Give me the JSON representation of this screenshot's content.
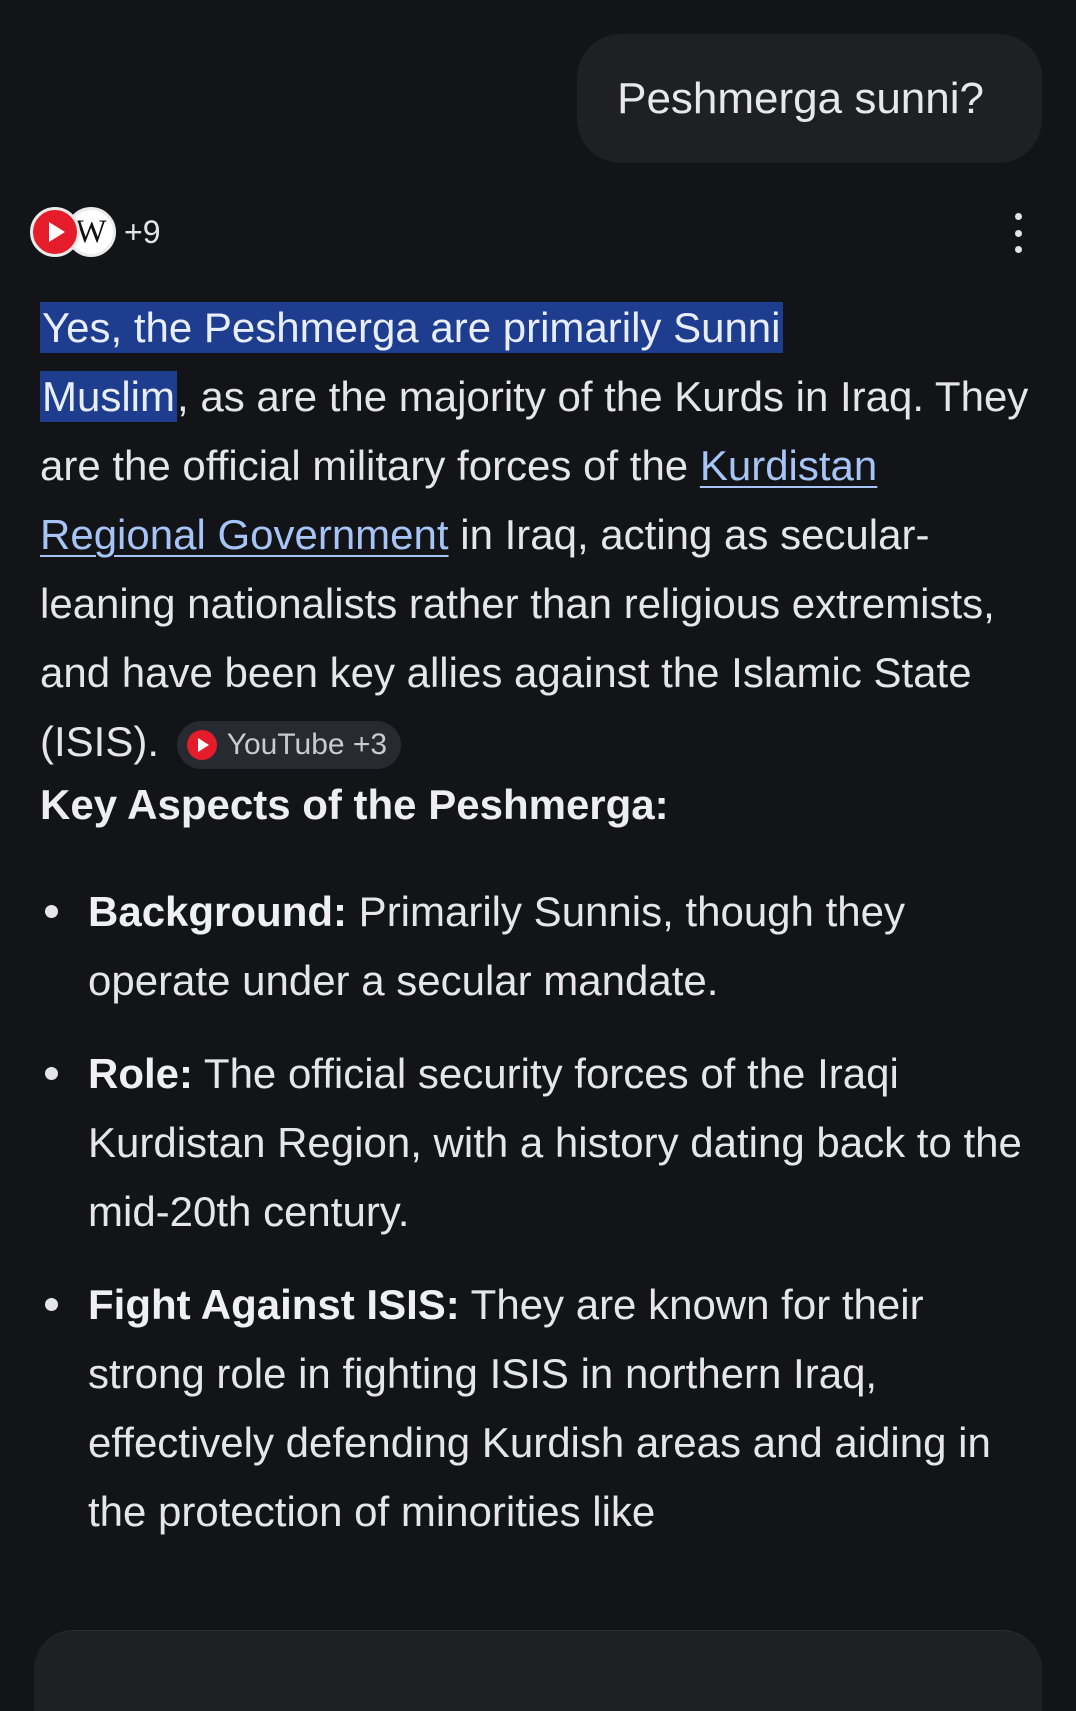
{
  "user_message": "Peshmerga sunni?",
  "sources": {
    "icons": [
      "youtube-icon",
      "wikipedia-icon"
    ],
    "wiki_glyph": "W",
    "extra_count": "+9"
  },
  "answer": {
    "highlight_1": "Yes, the Peshmerga are primarily Sunni",
    "highlight_2": "Muslim",
    "text_1": ", as are the majority of the Kurds in Iraq. They are the official military forces of the ",
    "link_text": "Kurdistan Regional Government",
    "text_2": " in Iraq, acting as secular-leaning nationalists rather than religious extremists, and have been key allies against the Islamic State (ISIS).",
    "citation_chip": "YouTube +3"
  },
  "heading": "Key Aspects of the Peshmerga:",
  "bullets": [
    {
      "label": "Background:",
      "text": " Primarily Sunnis, though they operate under a secular mandate."
    },
    {
      "label": "Role:",
      "text": " The official security forces of the Iraqi Kurdistan Region, with a history dating back to the mid-20th century."
    },
    {
      "label": "Fight Against ISIS:",
      "text": " They are known for their strong role in fighting ISIS in northern Iraq, effectively defending Kurdish areas and aiding in the protection of minorities like"
    }
  ],
  "colors": {
    "background": "#131417",
    "bubble": "#1f2024",
    "highlight": "#1e3d8f",
    "link": "#a7c4f7",
    "youtube_red": "#e51d2a"
  }
}
